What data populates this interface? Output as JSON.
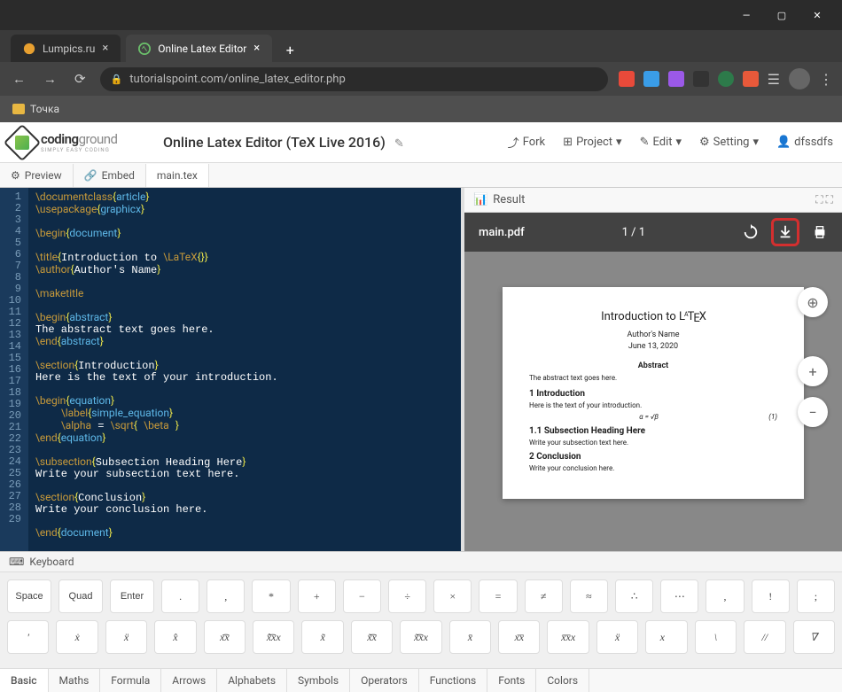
{
  "window": {
    "min": "—",
    "max": "▢",
    "close": "✕"
  },
  "tabs": [
    {
      "title": "Lumpics.ru",
      "active": false
    },
    {
      "title": "Online Latex Editor",
      "active": true
    }
  ],
  "url": "tutorialspoint.com/online_latex_editor.php",
  "bookmark": "Точка",
  "logo": {
    "word1": "coding",
    "word2": "ground",
    "tagline": "SIMPLY EASY CODING"
  },
  "app_title": "Online Latex Editor (TeX Live 2016)",
  "header_menu": {
    "fork": "Fork",
    "project": "Project",
    "edit": "Edit",
    "setting": "Setting",
    "user": "dfssdfs"
  },
  "editor_tabs": {
    "preview": "Preview",
    "embed": "Embed",
    "file": "main.tex"
  },
  "code_lines": 29,
  "result": {
    "label": "Result",
    "filename": "main.pdf",
    "page": "1 / 1"
  },
  "pdf": {
    "title_prefix": "Introduction to ",
    "title_latex": "LᴬTᴇX",
    "author": "Author's Name",
    "date": "June 13, 2020",
    "abstract_h": "Abstract",
    "abstract": "The abstract text goes here.",
    "sec1": "1   Introduction",
    "sec1_txt": "Here is the text of your introduction.",
    "eq": "α = √β",
    "eqnum": "(1)",
    "sec11": "1.1   Subsection Heading Here",
    "sec11_txt": "Write your subsection text here.",
    "sec2": "2   Conclusion",
    "sec2_txt": "Write your conclusion here."
  },
  "keyboard": {
    "label": "Keyboard",
    "row1_named": [
      "Space",
      "Quad",
      "Enter"
    ],
    "row1_sym": [
      ".",
      ",",
      "*",
      "+",
      "−",
      "÷",
      "×",
      "=",
      "≠",
      "≈",
      "∴",
      "⋯",
      ",",
      "!",
      ";"
    ],
    "row2": [
      "′",
      "ẋ",
      "ẍ",
      "x̂",
      "x͡x",
      "x̂͡xx",
      "x̃",
      "x̃͡x",
      "x̃͡xx",
      "x̄",
      "x͞x",
      "x̄͞xx",
      "ẍ",
      "x⃗",
      "\\",
      "//",
      "∇"
    ],
    "tabs": [
      "Basic",
      "Maths",
      "Formula",
      "Arrows",
      "Alphabets",
      "Symbols",
      "Operators",
      "Functions",
      "Fonts",
      "Colors"
    ]
  }
}
